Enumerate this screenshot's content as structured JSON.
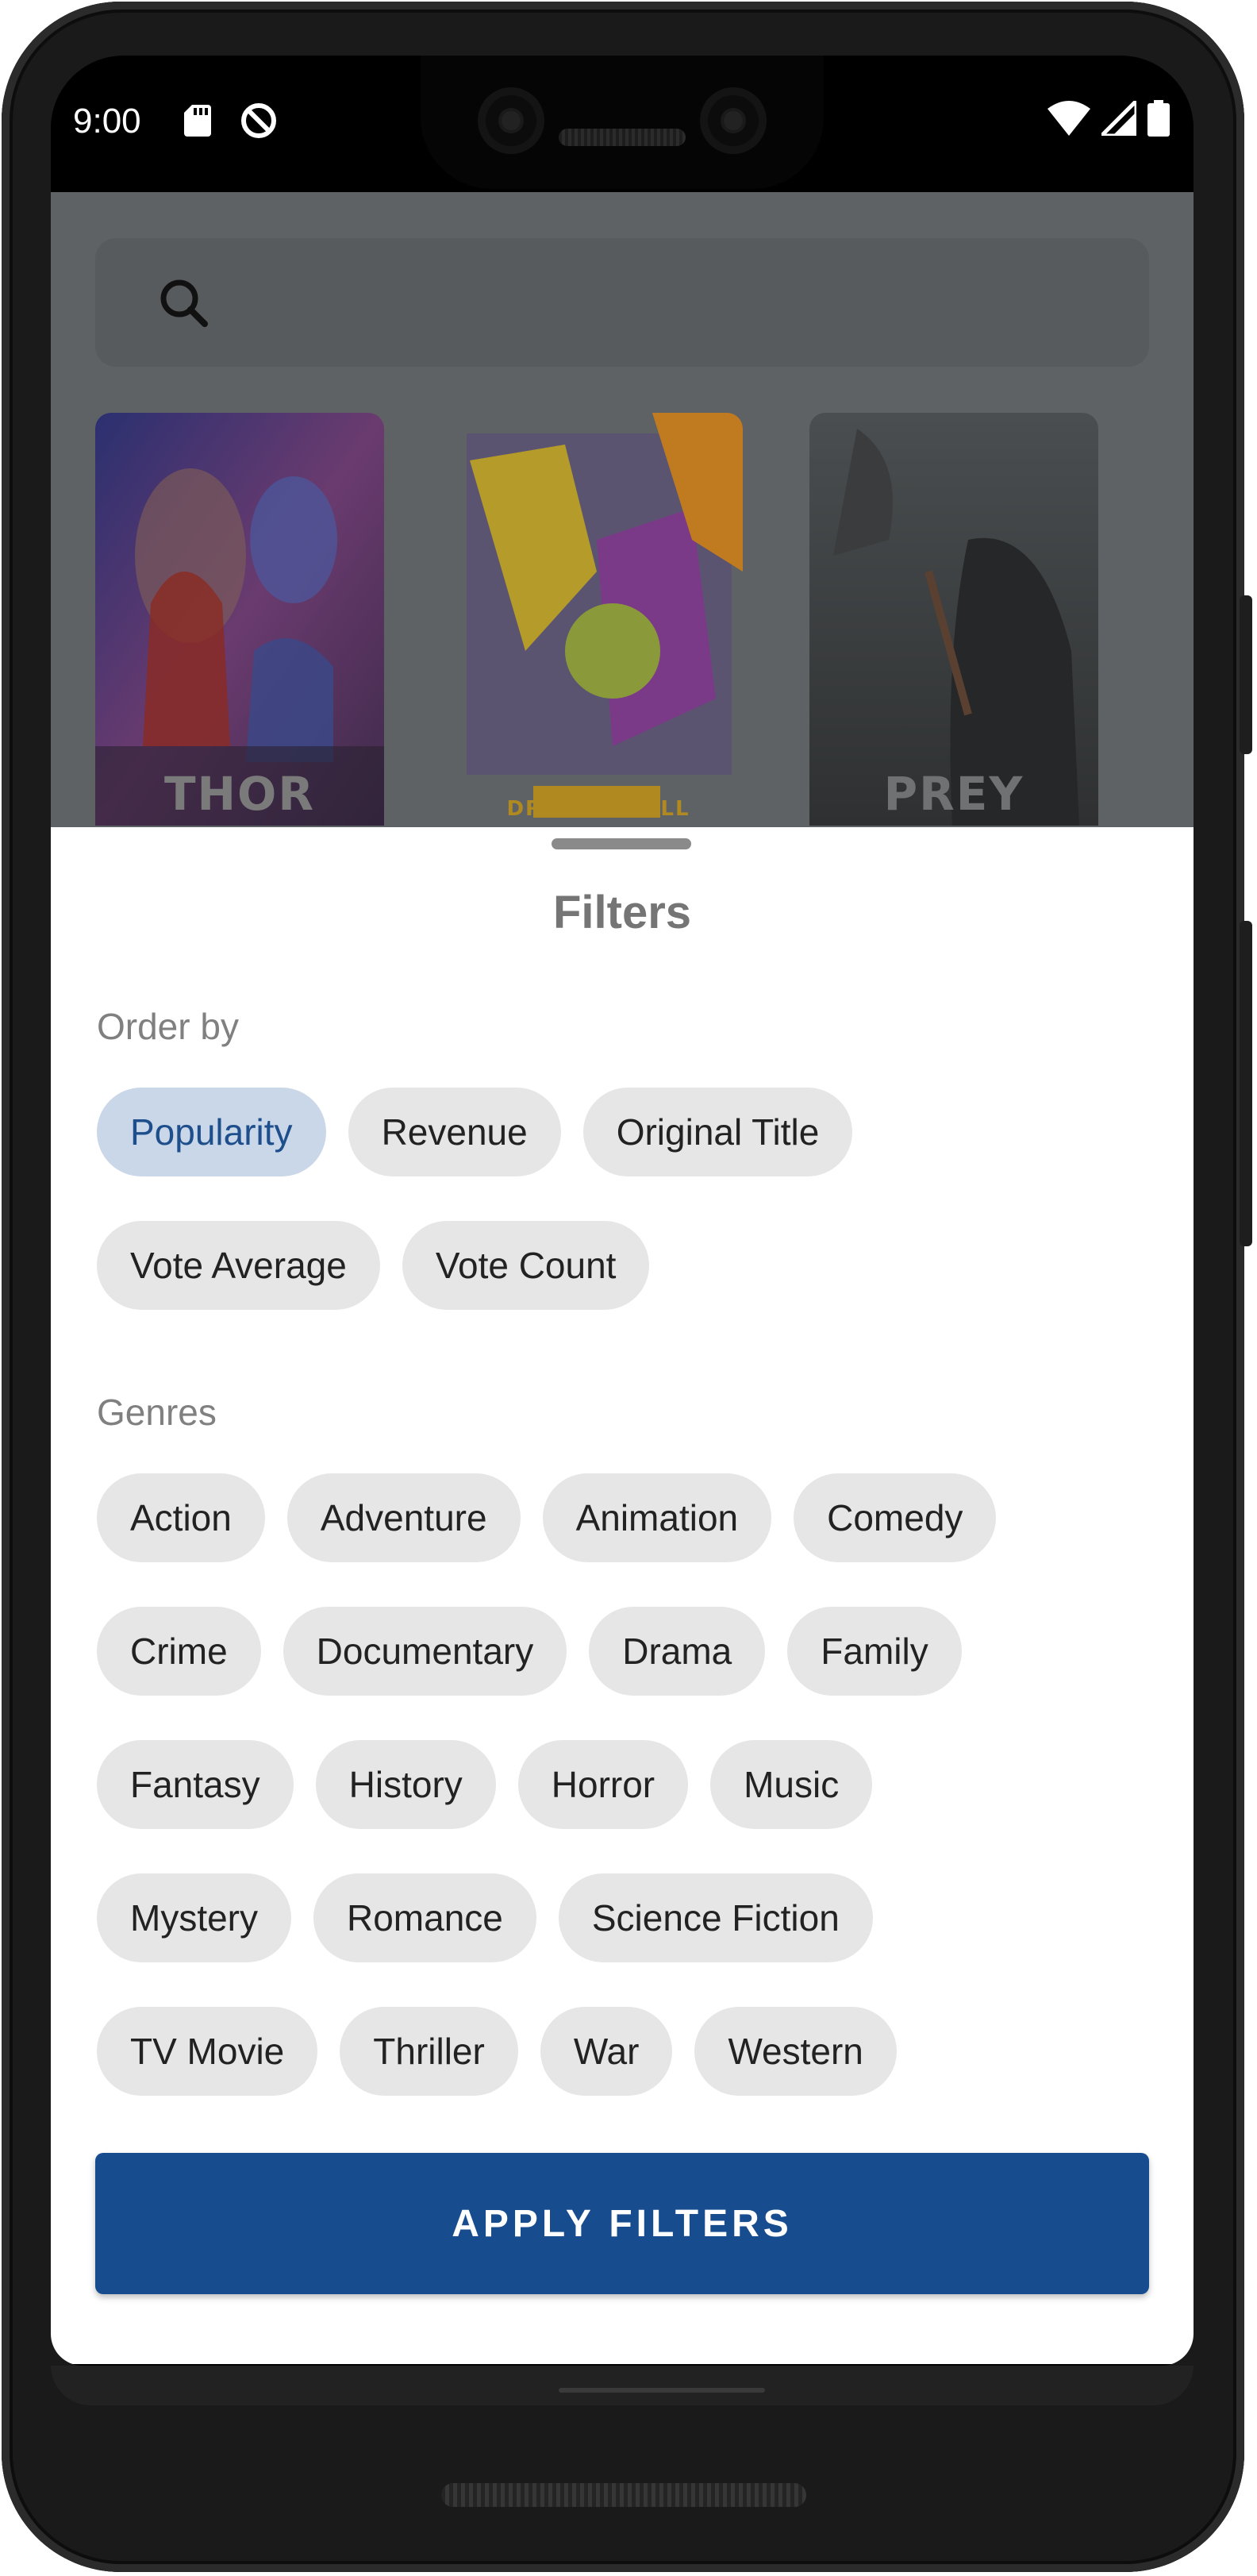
{
  "status_bar": {
    "time": "9:00",
    "icons": [
      "sd-card-icon",
      "do-not-disturb-icon",
      "wifi-icon",
      "cellular-signal-icon",
      "battery-icon"
    ]
  },
  "search": {
    "icon": "search-icon"
  },
  "posters": [
    {
      "label": "THOR",
      "colors": [
        "#3a3f8a",
        "#c23a2a",
        "#7a4aa0"
      ]
    },
    {
      "label": "DRAGON BALL",
      "colors": [
        "#d8b000",
        "#7a2e8e",
        "#2a3a7a"
      ]
    },
    {
      "label": "PREY",
      "colors": [
        "#3c3f41",
        "#555a5c",
        "#2a2c2d"
      ]
    }
  ],
  "filters": {
    "title": "Filters",
    "order_by": {
      "label": "Order by",
      "options": [
        "Popularity",
        "Revenue",
        "Original Title",
        "Vote Average",
        "Vote Count"
      ],
      "selected": "Popularity"
    },
    "genres": {
      "label": "Genres",
      "options": [
        "Action",
        "Adventure",
        "Animation",
        "Comedy",
        "Crime",
        "Documentary",
        "Drama",
        "Family",
        "Fantasy",
        "History",
        "Horror",
        "Music",
        "Mystery",
        "Romance",
        "Science Fiction",
        "TV Movie",
        "Thriller",
        "War",
        "Western"
      ]
    },
    "apply_label": "APPLY FILTERS"
  },
  "colors": {
    "accent": "#174d8f",
    "chip_selected_bg": "#c9d7e8",
    "chip_selected_text": "#1e4f8c",
    "chip_bg": "#e6e6e6"
  }
}
